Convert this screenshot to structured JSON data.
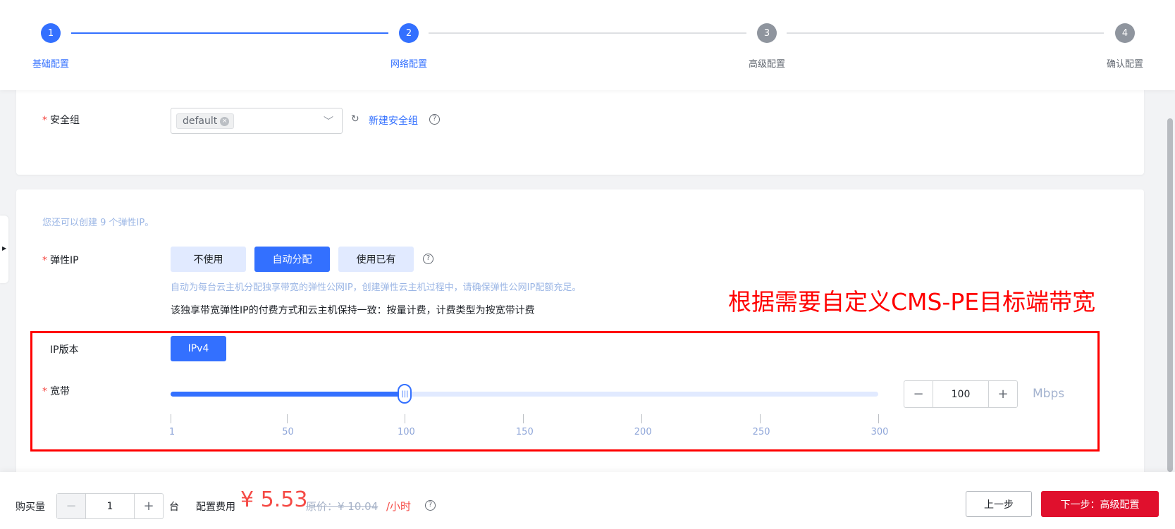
{
  "steps": [
    {
      "num": "1",
      "label": "基础配置"
    },
    {
      "num": "2",
      "label": "网络配置"
    },
    {
      "num": "3",
      "label": "高级配置"
    },
    {
      "num": "4",
      "label": "确认配置"
    }
  ],
  "security_group": {
    "label": "安全组",
    "required_mark": "*",
    "selected_tag": "default",
    "tag_remove": "×",
    "chevron": "﹀",
    "refresh": "↻",
    "new_link": "新建安全组",
    "help": "?"
  },
  "elastic_ip": {
    "quota_hint": "您还可以创建 9 个弹性IP。",
    "label": "弹性IP",
    "required_mark": "*",
    "options": [
      "不使用",
      "自动分配",
      "使用已有"
    ],
    "selected_option": "自动分配",
    "help": "?",
    "auto_hint": "自动为每台云主机分配独享带宽的弹性公网IP，创建弹性云主机过程中，请确保弹性公网IP配额充足。",
    "billing_note": "该独享带宽弹性IP的付费方式和云主机保持一致：按量计费，计费类型为按宽带计费"
  },
  "annotation": {
    "text": "根据需要自定义CMS-PE目标端带宽",
    "color": "#ff0000"
  },
  "ip_version": {
    "label": "IP版本",
    "value": "IPv4"
  },
  "bandwidth": {
    "label": "宽带",
    "required_mark": "*",
    "min": 1,
    "max": 300,
    "value": 100,
    "value_text": "100",
    "tick_labels": [
      "1",
      "50",
      "100",
      "150",
      "200",
      "250",
      "300"
    ],
    "minus": "−",
    "plus": "+",
    "unit": "Mbps"
  },
  "footer": {
    "qty_label": "购买量",
    "qty_value": "1",
    "minus": "−",
    "plus": "+",
    "qty_unit": "台",
    "cost_label": "配置费用",
    "price": "¥ 5.53",
    "original_price": "原价：¥ 10.04",
    "per_unit": "/小时",
    "help": "?",
    "prev_button": "上一步",
    "next_button": "下一步：高级配置"
  },
  "colors": {
    "primary": "#3370ff",
    "danger": "#e0102d",
    "price": "#f54a45"
  }
}
